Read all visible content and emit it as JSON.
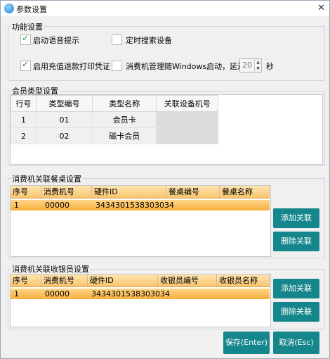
{
  "window": {
    "title": "参数设置"
  },
  "func": {
    "label": "功能设置",
    "voice": "启动语音提示",
    "search": "定时搜索设备",
    "print": "启用充值退款打印凭证",
    "autostart": "消费机管理随Windows启动，延迟",
    "delay": "20",
    "unit": "秒"
  },
  "member": {
    "label": "会员类型设置",
    "headers": [
      "行号",
      "类型编号",
      "类型名称",
      "关联设备机号"
    ],
    "rows": [
      [
        "1",
        "01",
        "会员卡",
        ""
      ],
      [
        "2",
        "02",
        "磁卡会员",
        ""
      ]
    ]
  },
  "table_link": {
    "label": "消费机关联餐桌设置",
    "headers": [
      "序号",
      "消费机号",
      "硬件ID",
      "餐桌编号",
      "餐桌名称"
    ],
    "row": [
      "1",
      "00000",
      "3434301538303034",
      "",
      ""
    ],
    "add": "添加关联",
    "del": "删除关联"
  },
  "cashier_link": {
    "label": "消费机关联收银员设置",
    "headers": [
      "序号",
      "消费机号",
      "硬件ID",
      "收银员编号",
      "收银员名称"
    ],
    "row": [
      "1",
      "00000",
      "3434301538303034",
      "",
      ""
    ],
    "add": "添加关联",
    "del": "删除关联"
  },
  "footer": {
    "save": "保存(Enter)",
    "cancel": "取消(Esc)"
  },
  "colors": {
    "button": "#15868c",
    "selection": "#f6ae3c"
  }
}
